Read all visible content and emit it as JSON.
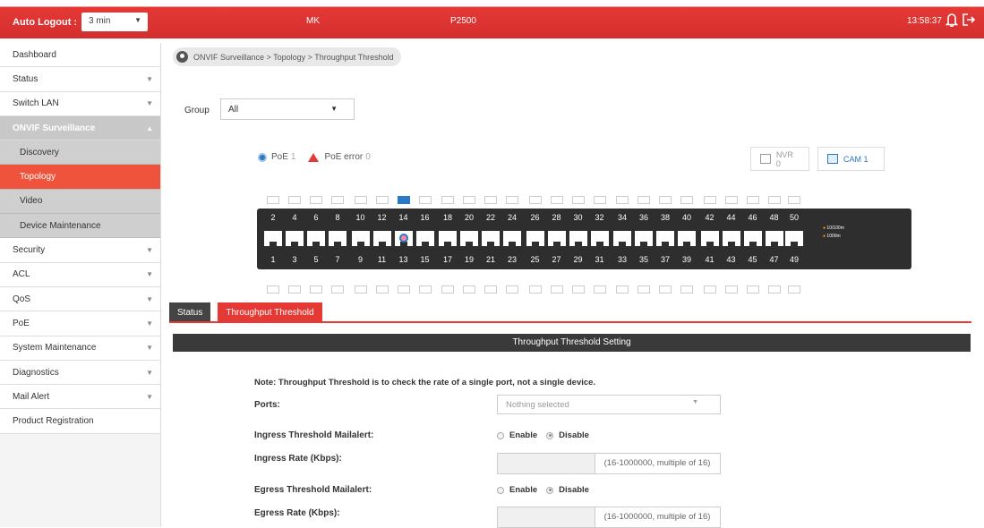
{
  "topbar": {
    "auto_logout_label": "Auto Logout :",
    "auto_logout_value": "3 min",
    "user": "MK",
    "model": "P2500",
    "time": "13:58:37",
    "accent": "#d32f2f"
  },
  "sidebar": {
    "items": [
      {
        "label": "Dashboard"
      },
      {
        "label": "Status"
      },
      {
        "label": "Switch LAN"
      },
      {
        "label": "ONVIF Surveillance"
      },
      {
        "label": "Discovery"
      },
      {
        "label": "Topology"
      },
      {
        "label": "Video"
      },
      {
        "label": "Device Maintenance"
      },
      {
        "label": "Security"
      },
      {
        "label": "ACL"
      },
      {
        "label": "QoS"
      },
      {
        "label": "PoE"
      },
      {
        "label": "System Maintenance"
      },
      {
        "label": "Diagnostics"
      },
      {
        "label": "Mail Alert"
      },
      {
        "label": "Product Registration"
      }
    ]
  },
  "breadcrumb": "ONVIF Surveillance > Topology > Throughput Threshold",
  "group": {
    "label": "Group",
    "value": "All"
  },
  "legend": {
    "poe": "PoE",
    "poe_count": "1",
    "poe_error": "PoE error",
    "poe_error_count": "0"
  },
  "devices": {
    "nvr": "NVR 0",
    "cam": "CAM 1"
  },
  "switch": {
    "top_numbers": [
      "2",
      "4",
      "6",
      "8",
      "10",
      "12",
      "14",
      "16",
      "18",
      "20",
      "22",
      "24",
      "26",
      "28",
      "30",
      "32",
      "34",
      "36",
      "38",
      "40",
      "42",
      "44",
      "46",
      "48",
      "50"
    ],
    "bottom_numbers": [
      "1",
      "3",
      "5",
      "7",
      "9",
      "11",
      "13",
      "15",
      "17",
      "19",
      "21",
      "23",
      "25",
      "27",
      "29",
      "31",
      "33",
      "35",
      "37",
      "39",
      "41",
      "43",
      "45",
      "47",
      "49"
    ],
    "speed_legend": [
      "10/100m",
      "1000m"
    ]
  },
  "tabs": [
    "Status",
    "Throughput Threshold"
  ],
  "setting": {
    "header": "Throughput Threshold Setting",
    "note": "Note: Throughput Threshold is to check the rate of a single port, not a single device.",
    "ports_label": "Ports:",
    "ports_placeholder": "Nothing selected",
    "ingress_mail_label": "Ingress Threshold Mailalert:",
    "ingress_rate_label": "Ingress Rate (Kbps):",
    "egress_mail_label": "Egress Threshold Mailalert:",
    "egress_rate_label": "Egress Rate (Kbps):",
    "enable": "Enable",
    "disable": "Disable",
    "rate_hint": "(16-1000000, multiple of 16)"
  }
}
